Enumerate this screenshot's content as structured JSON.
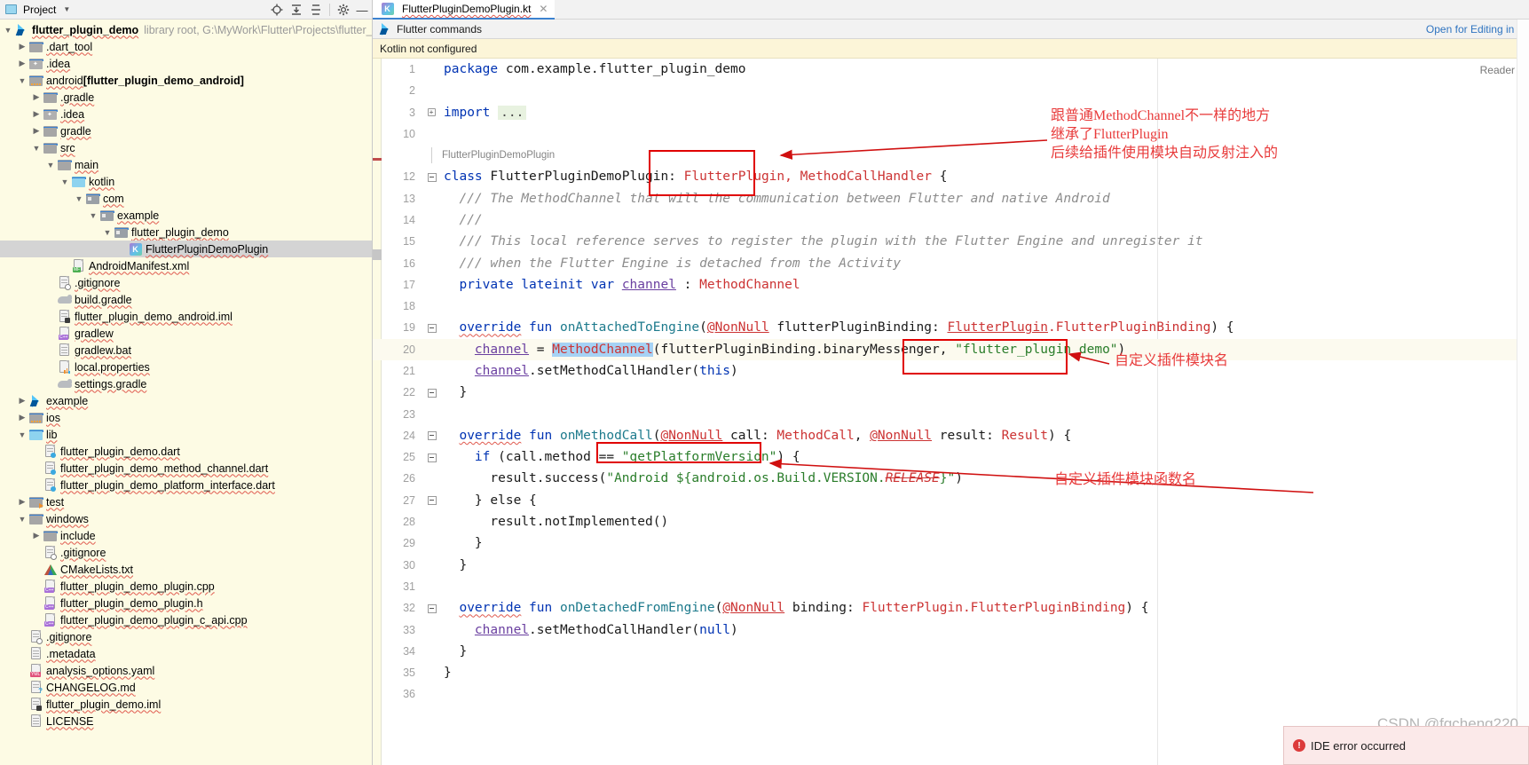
{
  "project_panel": {
    "title": "Project",
    "caret_icon": "chevron-down-icon",
    "toolbar_icons": [
      "locate-icon",
      "expand-all-icon",
      "collapse-all-icon",
      "gear-icon",
      "minimize-icon"
    ],
    "root": {
      "label": "flutter_plugin_demo",
      "meta": "library root,  G:\\MyWork\\Flutter\\Projects\\flutter_plu"
    },
    "items": [
      {
        "label": ".dart_tool",
        "icon": "folder-icon",
        "indent": 1,
        "arrow": "right",
        "selected": false
      },
      {
        "label": ".idea",
        "icon": "folder-idea-icon",
        "indent": 1,
        "arrow": "right",
        "selected": false
      },
      {
        "label": "android",
        "suffix": " [flutter_plugin_demo_android]",
        "icon": "folder-android-icon",
        "indent": 1,
        "arrow": "down",
        "selected": false,
        "bold": true
      },
      {
        "label": ".gradle",
        "icon": "folder-icon",
        "indent": 2,
        "arrow": "right",
        "selected": false
      },
      {
        "label": ".idea",
        "icon": "folder-idea-icon",
        "indent": 2,
        "arrow": "right",
        "selected": false
      },
      {
        "label": "gradle",
        "icon": "folder-icon",
        "indent": 2,
        "arrow": "right",
        "selected": false
      },
      {
        "label": "src",
        "icon": "folder-icon",
        "indent": 2,
        "arrow": "down",
        "selected": false
      },
      {
        "label": "main",
        "icon": "folder-icon",
        "indent": 3,
        "arrow": "down",
        "selected": false
      },
      {
        "label": "kotlin",
        "icon": "folder-source-icon",
        "indent": 4,
        "arrow": "down",
        "selected": false
      },
      {
        "label": "com",
        "icon": "package-icon",
        "indent": 5,
        "arrow": "down",
        "selected": false
      },
      {
        "label": "example",
        "icon": "package-icon",
        "indent": 6,
        "arrow": "down",
        "selected": false
      },
      {
        "label": "flutter_plugin_demo",
        "icon": "package-icon",
        "indent": 7,
        "arrow": "down",
        "selected": false
      },
      {
        "label": "FlutterPluginDemoPlugin",
        "icon": "kotlin-class-icon",
        "indent": 8,
        "arrow": "none",
        "selected": true
      },
      {
        "label": "AndroidManifest.xml",
        "icon": "manifest-file-icon",
        "indent": 4,
        "arrow": "none",
        "selected": false
      },
      {
        "label": ".gitignore",
        "icon": "gitignore-file-icon",
        "indent": 3,
        "arrow": "none",
        "selected": false
      },
      {
        "label": "build.gradle",
        "icon": "gradle-file-icon",
        "indent": 3,
        "arrow": "none",
        "selected": false
      },
      {
        "label": "flutter_plugin_demo_android.iml",
        "icon": "iml-file-icon",
        "indent": 3,
        "arrow": "none",
        "selected": false
      },
      {
        "label": "gradlew",
        "icon": "cpp-file-icon",
        "indent": 3,
        "arrow": "none",
        "selected": false
      },
      {
        "label": "gradlew.bat",
        "icon": "text-file-icon",
        "indent": 3,
        "arrow": "none",
        "selected": false
      },
      {
        "label": "local.properties",
        "icon": "properties-file-icon",
        "indent": 3,
        "arrow": "none",
        "selected": false
      },
      {
        "label": "settings.gradle",
        "icon": "gradle-file-icon",
        "indent": 3,
        "arrow": "none",
        "selected": false
      },
      {
        "label": "example",
        "icon": "flutter-icon",
        "indent": 1,
        "arrow": "right",
        "selected": false
      },
      {
        "label": "ios",
        "icon": "folder-android-icon",
        "indent": 1,
        "arrow": "right",
        "selected": false
      },
      {
        "label": "lib",
        "icon": "folder-source-icon",
        "indent": 1,
        "arrow": "down",
        "selected": false
      },
      {
        "label": "flutter_plugin_demo.dart",
        "icon": "dart-file-icon",
        "indent": 2,
        "arrow": "none",
        "selected": false
      },
      {
        "label": "flutter_plugin_demo_method_channel.dart",
        "icon": "dart-file-icon",
        "indent": 2,
        "arrow": "none",
        "selected": false
      },
      {
        "label": "flutter_plugin_demo_platform_interface.dart",
        "icon": "dart-file-icon",
        "indent": 2,
        "arrow": "none",
        "selected": false
      },
      {
        "label": "test",
        "icon": "folder-test-icon",
        "indent": 1,
        "arrow": "right",
        "selected": false
      },
      {
        "label": "windows",
        "icon": "folder-icon",
        "indent": 1,
        "arrow": "down",
        "selected": false
      },
      {
        "label": "include",
        "icon": "folder-icon",
        "indent": 2,
        "arrow": "right",
        "selected": false
      },
      {
        "label": ".gitignore",
        "icon": "gitignore-file-icon",
        "indent": 2,
        "arrow": "none",
        "selected": false
      },
      {
        "label": "CMakeLists.txt",
        "icon": "cmake-file-icon",
        "indent": 2,
        "arrow": "none",
        "selected": false
      },
      {
        "label": "flutter_plugin_demo_plugin.cpp",
        "icon": "cpp-file-icon",
        "indent": 2,
        "arrow": "none",
        "selected": false
      },
      {
        "label": "flutter_plugin_demo_plugin.h",
        "icon": "cpp-file-icon",
        "indent": 2,
        "arrow": "none",
        "selected": false
      },
      {
        "label": "flutter_plugin_demo_plugin_c_api.cpp",
        "icon": "cpp-file-icon",
        "indent": 2,
        "arrow": "none",
        "selected": false
      },
      {
        "label": ".gitignore",
        "icon": "gitignore-file-icon",
        "indent": 1,
        "arrow": "none",
        "selected": false
      },
      {
        "label": ".metadata",
        "icon": "text-file-icon",
        "indent": 1,
        "arrow": "none",
        "selected": false
      },
      {
        "label": "analysis_options.yaml",
        "icon": "yaml-file-icon",
        "indent": 1,
        "arrow": "none",
        "selected": false
      },
      {
        "label": "CHANGELOG.md",
        "icon": "markdown-file-icon",
        "indent": 1,
        "arrow": "none",
        "selected": false
      },
      {
        "label": "flutter_plugin_demo.iml",
        "icon": "iml-file-icon",
        "indent": 1,
        "arrow": "none",
        "selected": false
      },
      {
        "label": "LICENSE",
        "icon": "text-file-icon",
        "indent": 1,
        "arrow": "none",
        "selected": false
      }
    ]
  },
  "editor": {
    "tab": {
      "label": "FlutterPluginDemoPlugin.kt",
      "icon": "kotlin-class-icon",
      "close_icon": "close-icon"
    },
    "command_bar": {
      "label": "Flutter commands",
      "icon": "flutter-icon"
    },
    "open_for_editing": "Open for Editing in A",
    "notification": "Kotlin not configured",
    "reader_label": "Reader",
    "breadcrumb": "FlutterPluginDemoPlugin",
    "lines": [
      {
        "n": "1",
        "fold": "",
        "text": "package_line"
      },
      {
        "n": "2",
        "fold": "",
        "text": ""
      },
      {
        "n": "3",
        "fold": "plus",
        "text": "import_line"
      },
      {
        "n": "10",
        "fold": "",
        "text": ""
      },
      {
        "n": "",
        "fold": "",
        "text": "breadcrumb"
      },
      {
        "n": "12",
        "fold": "minus",
        "text": "class_line",
        "hl": false
      },
      {
        "n": "13",
        "fold": "",
        "text": "doc1"
      },
      {
        "n": "14",
        "fold": "",
        "text": "doc2"
      },
      {
        "n": "15",
        "fold": "",
        "text": "doc3"
      },
      {
        "n": "16",
        "fold": "",
        "text": "doc4"
      },
      {
        "n": "17",
        "fold": "",
        "text": "field"
      },
      {
        "n": "18",
        "fold": "",
        "text": ""
      },
      {
        "n": "19",
        "fold": "minus",
        "text": "onattached"
      },
      {
        "n": "20",
        "fold": "",
        "text": "channel_assign",
        "hl": true
      },
      {
        "n": "21",
        "fold": "",
        "text": "sethandler"
      },
      {
        "n": "22",
        "fold": "minus",
        "text": "closebrace1"
      },
      {
        "n": "23",
        "fold": "",
        "text": ""
      },
      {
        "n": "24",
        "fold": "minus",
        "text": "onmethodcall"
      },
      {
        "n": "25",
        "fold": "minus",
        "text": "ifcall"
      },
      {
        "n": "26",
        "fold": "",
        "text": "success"
      },
      {
        "n": "27",
        "fold": "minus",
        "text": "else"
      },
      {
        "n": "28",
        "fold": "",
        "text": "notimpl"
      },
      {
        "n": "29",
        "fold": "",
        "text": "closebrace2"
      },
      {
        "n": "30",
        "fold": "",
        "text": "closebrace3"
      },
      {
        "n": "31",
        "fold": "",
        "text": ""
      },
      {
        "n": "32",
        "fold": "minus",
        "text": "ondetached"
      },
      {
        "n": "33",
        "fold": "",
        "text": "setnull"
      },
      {
        "n": "34",
        "fold": "",
        "text": "closebrace4"
      },
      {
        "n": "35",
        "fold": "",
        "text": "closebrace5"
      },
      {
        "n": "36",
        "fold": "",
        "text": ""
      }
    ],
    "code": {
      "package_keyword": "package",
      "package_name": " com.example.flutter_plugin_demo",
      "import_keyword": "import",
      "import_ellipsis": "...",
      "class_keyword": "class",
      "class_name": " FlutterPluginDemoPlugin",
      "class_colon": ":",
      "class_super1": "FlutterPlugin",
      "class_comma": ",",
      "class_super2": " MethodCallHandler",
      "class_brace": " {",
      "doc1": "/// The MethodChannel that will the communication between Flutter and native Android",
      "doc2": "///",
      "doc3": "/// This local reference serves to register the plugin with the Flutter Engine and unregister it",
      "doc4": "/// when the Flutter Engine is detached from the Activity",
      "field_private": "private",
      "field_lateinit": " lateinit",
      "field_var": " var",
      "field_name": "channel",
      "field_type": " : MethodChannel",
      "ov": "override",
      "fun": " fun ",
      "fn_onattached": "onAttachedToEngine",
      "nonnull": "@NonNull",
      "param_binding": " flutterPluginBinding: ",
      "type_flutterplugin": "FlutterPlugin",
      "type_binding": ".FlutterPluginBinding",
      "close_brace_open": ") {",
      "ch": "channel",
      "eq": " = ",
      "methodchannel": "MethodChannel",
      "mc_args": "(flutterPluginBinding.binaryMessenger, ",
      "channel_name": "\"flutter_plugin_demo\"",
      "mc_close": ")",
      "setmethodcallhandler": ".setMethodCallHandler(",
      "this_kw": "this",
      "paren_close": ")",
      "brace_close": "}",
      "fn_onmethodcall": "onMethodCall",
      "call_param": " call: ",
      "type_methodcall": "MethodCall",
      "result_param": " result: ",
      "type_result": "Result",
      "if_kw": "if",
      "if_cond": " (call.method == ",
      "method_name": "\"getPlatformVersion\"",
      "if_tail": ") {",
      "result_success": "result.success(",
      "android_str": "\"Android ${android.os.Build.VERSION.",
      "release_strike": "RELEASE",
      "android_str_end": "}\"",
      "else_kw": "} else {",
      "not_impl": "result.notImplemented()",
      "fn_ondetached": "onDetachedFromEngine",
      "binding_param": " binding: ",
      "null_kw": "null"
    }
  },
  "annotations": [
    {
      "id": "annot-class-super",
      "text": "跟普通MethodChannel不一样的地方\n继承了FlutterPlugin\n后续给插件使用模块自动反射注入的"
    },
    {
      "id": "annot-channel-name",
      "text": "自定义插件模块名"
    },
    {
      "id": "annot-method-name",
      "text": "自定义插件模块函数名"
    }
  ],
  "status": {
    "error_text": "IDE error occurred",
    "error_icon": "error-icon",
    "watermark": "CSDN @fqcheng220"
  },
  "colors": {
    "annotation_red": "#e83b3b",
    "box_red": "#e00000",
    "tab_accent": "#3c82d0",
    "panel_bg": "#fdfbe4",
    "notification_bg": "#fcf5d8",
    "selection_blue": "#a6d2f4"
  }
}
